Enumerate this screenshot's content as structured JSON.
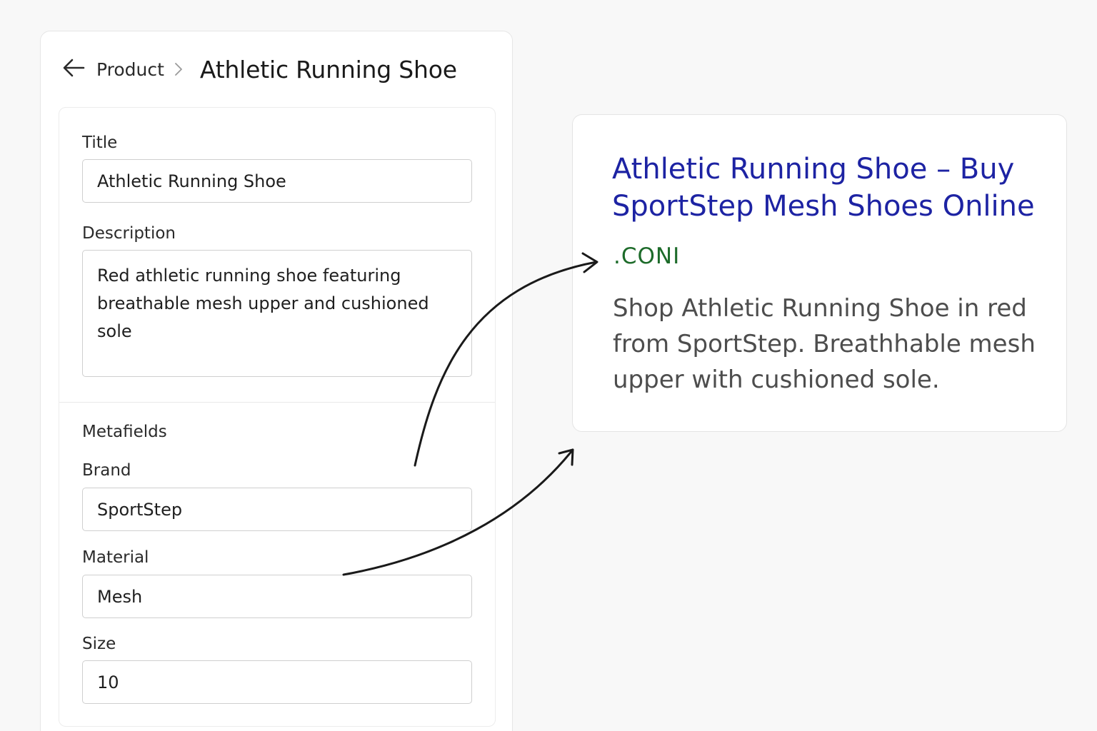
{
  "header": {
    "breadcrumb_parent": "Product",
    "title": "Athletic Running Shoe"
  },
  "form": {
    "title": {
      "label": "Title",
      "value": "Athletic Running Shoe"
    },
    "description": {
      "label": "Description",
      "value": "Red athletic running shoe featuring breathable mesh upper and cushioned sole"
    },
    "metafields_heading": "Metafields",
    "brand": {
      "label": "Brand",
      "value": "SportStep"
    },
    "material": {
      "label": "Material",
      "value": "Mesh"
    },
    "size": {
      "label": "Size",
      "value": "10"
    }
  },
  "preview": {
    "title": "Athletic Running Shoe – Buy SportStep Mesh Shoes Online",
    "url": ".CONI",
    "description": "Shop Athletic Running Shoe in red from SportStep. Breathhable mesh upper with cushioned sole."
  },
  "colors": {
    "link_title": "#1d23a3",
    "url_green": "#1d6b2a",
    "desc_gray": "#4d4d4d"
  }
}
